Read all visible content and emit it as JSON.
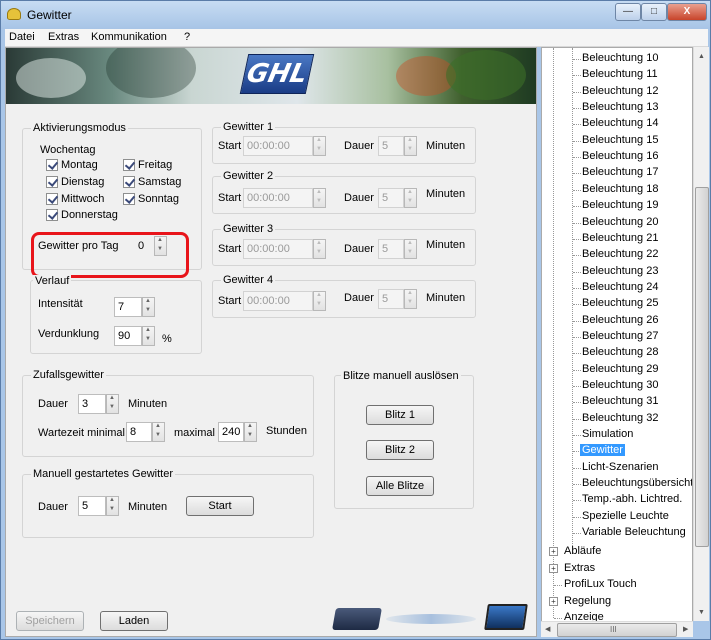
{
  "window": {
    "title": "Gewitter",
    "close_glyph": "X"
  },
  "menu": [
    "Datei",
    "Extras",
    "Kommunikation",
    "?"
  ],
  "banner": {
    "logo_text": "GHL"
  },
  "aktivierung": {
    "title": "Aktivierungsmodus",
    "wochentag_title": "Wochentag",
    "days": [
      "Montag",
      "Dienstag",
      "Mittwoch",
      "Donnerstag",
      "Freitag",
      "Samstag",
      "Sonntag"
    ],
    "gewitter_pro_tag_label": "Gewitter pro Tag",
    "gewitter_pro_tag_value": "0"
  },
  "verlauf": {
    "title": "Verlauf",
    "intensitaet_label": "Intensität",
    "intensitaet_value": "7",
    "verdunklung_label": "Verdunklung",
    "verdunklung_value": "90",
    "verdunklung_unit": "%"
  },
  "gewitter": [
    {
      "title": "Gewitter 1",
      "start_label": "Start",
      "start_value": "00:00:00",
      "dauer_label": "Dauer",
      "dauer_value": "5",
      "unit": "Minuten"
    },
    {
      "title": "Gewitter 2",
      "start_label": "Start",
      "start_value": "00:00:00",
      "dauer_label": "Dauer",
      "dauer_value": "5",
      "unit": "Minuten"
    },
    {
      "title": "Gewitter 3",
      "start_label": "Start",
      "start_value": "00:00:00",
      "dauer_label": "Dauer",
      "dauer_value": "5",
      "unit": "Minuten"
    },
    {
      "title": "Gewitter 4",
      "start_label": "Start",
      "start_value": "00:00:00",
      "dauer_label": "Dauer",
      "dauer_value": "5",
      "unit": "Minuten"
    }
  ],
  "zufall": {
    "title": "Zufallsgewitter",
    "dauer_label": "Dauer",
    "dauer_value": "3",
    "dauer_unit": "Minuten",
    "wartezeit_label": "Wartezeit minimal",
    "wartezeit_min": "8",
    "maximal_label": "maximal",
    "wartezeit_max": "240",
    "wartezeit_unit": "Stunden"
  },
  "manuell": {
    "title": "Manuell gestartetes Gewitter",
    "dauer_label": "Dauer",
    "dauer_value": "5",
    "dauer_unit": "Minuten",
    "start_button": "Start"
  },
  "blitze": {
    "title": "Blitze manuell auslösen",
    "buttons": [
      "Blitz 1",
      "Blitz 2",
      "Alle Blitze"
    ]
  },
  "bottom": {
    "speichern": "Speichern",
    "laden": "Laden"
  },
  "tree": {
    "children": [
      "Beleuchtung 10",
      "Beleuchtung 11",
      "Beleuchtung 12",
      "Beleuchtung 13",
      "Beleuchtung 14",
      "Beleuchtung 15",
      "Beleuchtung 16",
      "Beleuchtung 17",
      "Beleuchtung 18",
      "Beleuchtung 19",
      "Beleuchtung 20",
      "Beleuchtung 21",
      "Beleuchtung 22",
      "Beleuchtung 23",
      "Beleuchtung 24",
      "Beleuchtung 25",
      "Beleuchtung 26",
      "Beleuchtung 27",
      "Beleuchtung 28",
      "Beleuchtung 29",
      "Beleuchtung 30",
      "Beleuchtung 31",
      "Beleuchtung 32",
      "Simulation",
      "Gewitter",
      "Licht-Szenarien",
      "Beleuchtungsübersicht",
      "Temp.-abh. Lichtred.",
      "Spezielle Leuchte",
      "Variable Beleuchtung"
    ],
    "selected": "Gewitter",
    "top_level": [
      {
        "label": "Abläufe",
        "expandable": true
      },
      {
        "label": "Extras",
        "expandable": true
      },
      {
        "label": "ProfiLux Touch",
        "expandable": false
      },
      {
        "label": "Regelung",
        "expandable": true
      },
      {
        "label": "Anzeige",
        "expandable": false
      }
    ],
    "scroll_glyph": "III"
  },
  "colors": {
    "highlight": "#e8141a",
    "selection": "#3399ff",
    "logo": "#2a55a8"
  }
}
